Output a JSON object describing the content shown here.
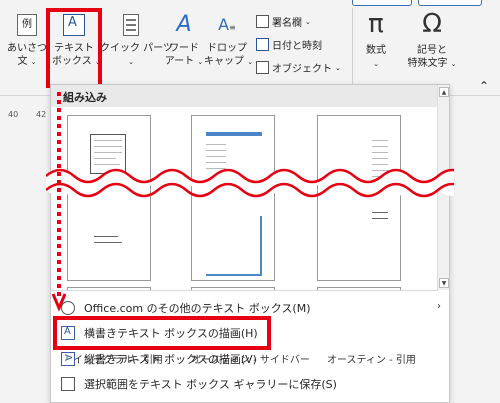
{
  "ribbon": {
    "items": {
      "aisatsu": {
        "line1": "あいさつ",
        "line2": "文",
        "icon_char": "例"
      },
      "textbox": {
        "line1": "テキスト",
        "line2": "ボックス"
      },
      "quickparts": {
        "line1": "クイック パーツ"
      },
      "wordart": {
        "line1": "ワード",
        "line2": "アート"
      },
      "dropcap": {
        "line1": "ドロップ",
        "line2": "キャップ"
      },
      "signature": {
        "label": "署名欄"
      },
      "datetime": {
        "label": "日付と時刻"
      },
      "object": {
        "label": "オブジェクト"
      },
      "equation": {
        "line1": "数式",
        "icon_char": "π"
      },
      "symbol": {
        "line1": "記号と",
        "line2": "特殊文字",
        "icon_char": "Ω"
      }
    }
  },
  "ruler": {
    "left": "40",
    "right": "42"
  },
  "gallery": {
    "header": "組み込み",
    "thumbs": [
      {
        "caption": "インテグラル - 引用"
      },
      {
        "caption": "オースティン - サイドバー"
      },
      {
        "caption": "オースティン - 引用"
      }
    ]
  },
  "menu": {
    "items": [
      {
        "label": "Office.com のその他のテキスト ボックス(M)"
      },
      {
        "label": "横書きテキスト ボックスの描画(H)"
      },
      {
        "label": "縦書きテキスト ボックスの描画(V)"
      },
      {
        "label": "選択範囲をテキスト ボックス ギャラリーに保存(S)"
      }
    ]
  },
  "colors": {
    "highlight": "#e60012",
    "accent": "#2b579a",
    "wave": "#e60012"
  }
}
